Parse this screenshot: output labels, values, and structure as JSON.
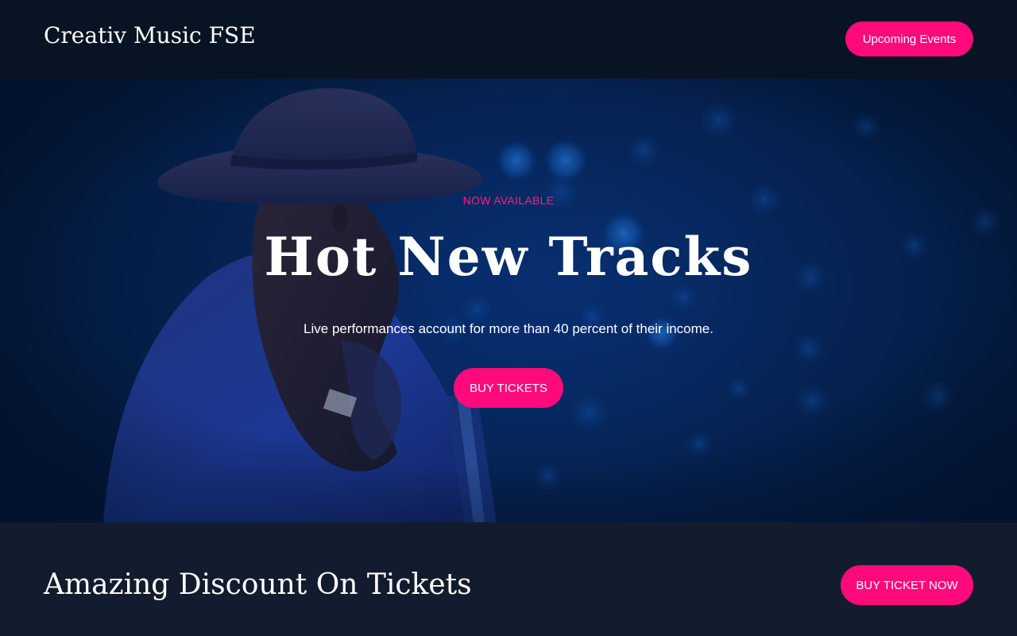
{
  "header": {
    "site_title": "Creativ Music FSE",
    "events_button": "Upcoming Events"
  },
  "hero": {
    "eyebrow": "NOW AVAILABLE",
    "title": "Hot New Tracks",
    "subtitle": "Live performances account for more than 40 percent of their income.",
    "cta_button": "BUY TICKETS",
    "image_description_icon": "guitarist-photo"
  },
  "cta_band": {
    "title": "Amazing Discount On Tickets",
    "button": "BUY TICKET NOW"
  },
  "colors": {
    "accent": "#ff0a7a",
    "header_bg": "#081424",
    "band_bg": "#131c2e",
    "hero_blue": "#06275c"
  }
}
